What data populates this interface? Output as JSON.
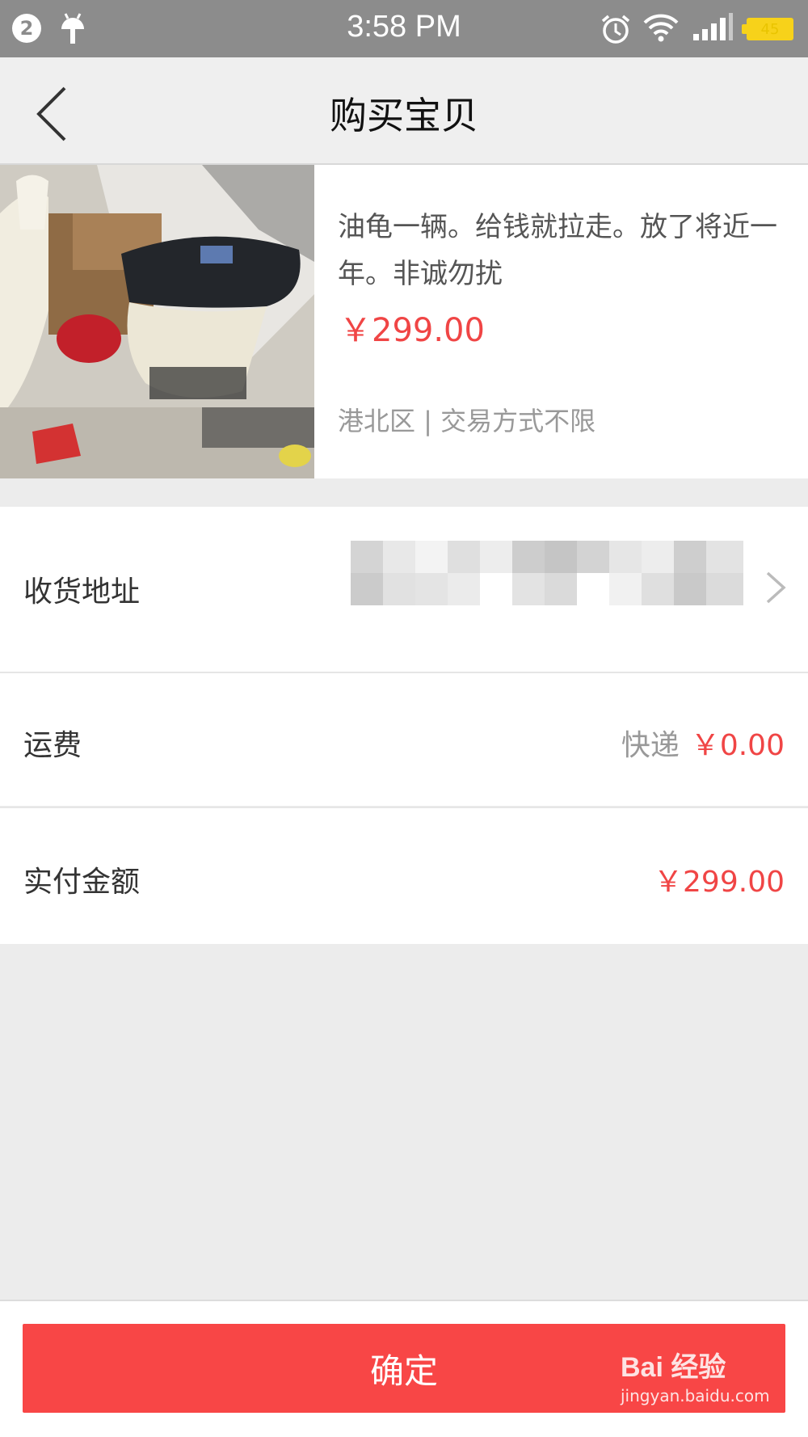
{
  "status_bar": {
    "notification_count": "2",
    "time": "3:58 PM",
    "battery_level": "45",
    "icons": [
      "android-icon",
      "alarm-icon",
      "wifi-icon",
      "signal-icon",
      "battery-icon"
    ]
  },
  "nav": {
    "title": "购买宝贝",
    "back_icon": "chevron-left-icon"
  },
  "product": {
    "title": "油龟一辆。给钱就拉走。放了将近一年。非诚勿扰",
    "price": "￥299.00",
    "location": "港北区 | 交易方式不限"
  },
  "address": {
    "label": "收货地址",
    "chevron_icon": "chevron-right-icon"
  },
  "freight": {
    "label": "运费",
    "method": "快递",
    "price": "￥0.00"
  },
  "total": {
    "label": "实付金额",
    "price": "￥299.00"
  },
  "confirm": {
    "label": "确定"
  },
  "watermark": {
    "main": "Bai 经验",
    "sub": "jingyan.baidu.com"
  },
  "colors": {
    "status_bar": "#8c8c8c",
    "accent_red": "#f84646",
    "price_red": "#f04545",
    "background": "#ececec"
  }
}
